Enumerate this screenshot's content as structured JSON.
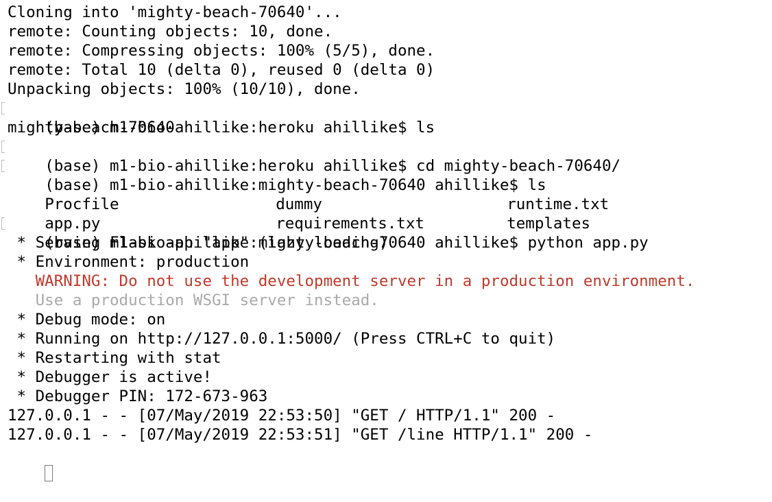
{
  "lines": [
    {
      "text": "Cloning into 'mighty-beach-70640'..."
    },
    {
      "text": "remote: Counting objects: 10, done."
    },
    {
      "text": "remote: Compressing objects: 100% (5/5), done."
    },
    {
      "text": "remote: Total 10 (delta 0), reused 0 (delta 0)"
    },
    {
      "text": "Unpacking objects: 100% (10/10), done."
    },
    {
      "text": "(base) m1-bio-ahillike:heroku ahillike$ ls"
    },
    {
      "text": "mighty-beach-70640"
    },
    {
      "text": "(base) m1-bio-ahillike:heroku ahillike$ cd mighty-beach-70640/"
    },
    {
      "text": "(base) m1-bio-ahillike:mighty-beach-70640 ahillike$ ls"
    },
    {
      "cols": [
        "Procfile",
        "dummy",
        "runtime.txt"
      ]
    },
    {
      "cols": [
        "app.py",
        "requirements.txt",
        "templates"
      ]
    },
    {
      "text": "(base) m1-bio-ahillike:mighty-beach-70640 ahillike$ python app.py"
    },
    {
      "text": " * Serving Flask app \"app\" (lazy loading)"
    },
    {
      "text": " * Environment: production"
    },
    {
      "text": "   WARNING: Do not use the development server in a production environment."
    },
    {
      "text": "   Use a production WSGI server instead."
    },
    {
      "text": " * Debug mode: on"
    },
    {
      "text": " * Running on http://127.0.0.1:5000/ (Press CTRL+C to quit)"
    },
    {
      "text": " * Restarting with stat"
    },
    {
      "text": " * Debugger is active!"
    },
    {
      "text": " * Debugger PIN: 172-673-963"
    },
    {
      "text": "127.0.0.1 - - [07/May/2019 22:53:50] \"GET / HTTP/1.1\" 200 -"
    },
    {
      "text": "127.0.0.1 - - [07/May/2019 22:53:51] \"GET /line HTTP/1.1\" 200 -"
    }
  ],
  "colors": {
    "background": "#ffffff",
    "text": "#000000",
    "warning": "#c0392b",
    "hint": "#a9a9a9"
  }
}
